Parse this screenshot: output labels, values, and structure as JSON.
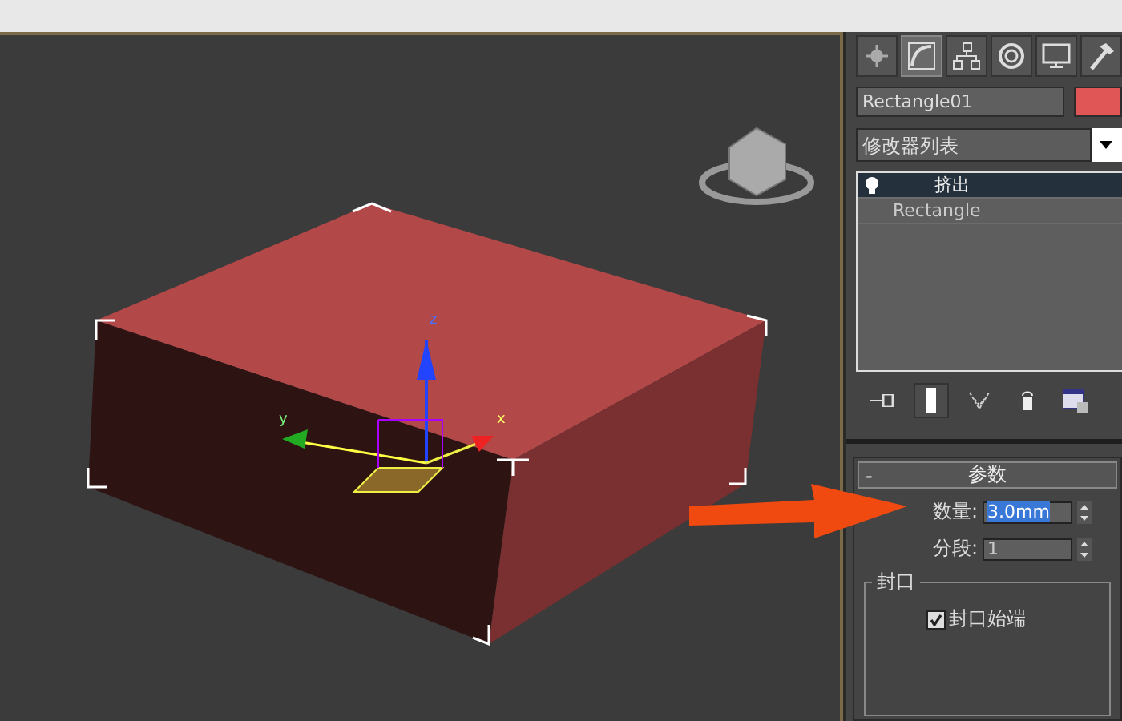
{
  "viewport": {
    "axis_labels": [
      {
        "kind": "z",
        "text": "z"
      },
      {
        "kind": "y",
        "text": "y"
      },
      {
        "kind": "x",
        "text": "x"
      }
    ]
  },
  "command_panel": {
    "tabs": [
      {
        "kind": "create",
        "selected": false
      },
      {
        "kind": "modify",
        "selected": true
      },
      {
        "kind": "hierarchy",
        "selected": false
      },
      {
        "kind": "motion",
        "selected": false
      },
      {
        "kind": "display",
        "selected": false
      },
      {
        "kind": "utilities",
        "selected": false
      }
    ],
    "object_name": "Rectangle01",
    "modifier_list": "修改器列表",
    "stack": [
      {
        "label": "挤出",
        "selected": true
      },
      {
        "label": "Rectangle",
        "selected": false
      }
    ],
    "stack_tools": [
      {
        "kind": "pin",
        "on": false
      },
      {
        "kind": "end-result",
        "on": true
      },
      {
        "kind": "unique",
        "on": false
      },
      {
        "kind": "remove",
        "on": false
      },
      {
        "kind": "configure",
        "on": false
      }
    ],
    "rollout": {
      "collapse": "-",
      "title": "参数",
      "fields": [
        {
          "label": "数量:",
          "value": "3.0mm",
          "selected": true
        },
        {
          "label": "分段:",
          "value": "1",
          "selected": false
        }
      ],
      "group": "封口",
      "checkboxes": [
        {
          "label": "封口始端",
          "checked": true
        }
      ]
    }
  }
}
